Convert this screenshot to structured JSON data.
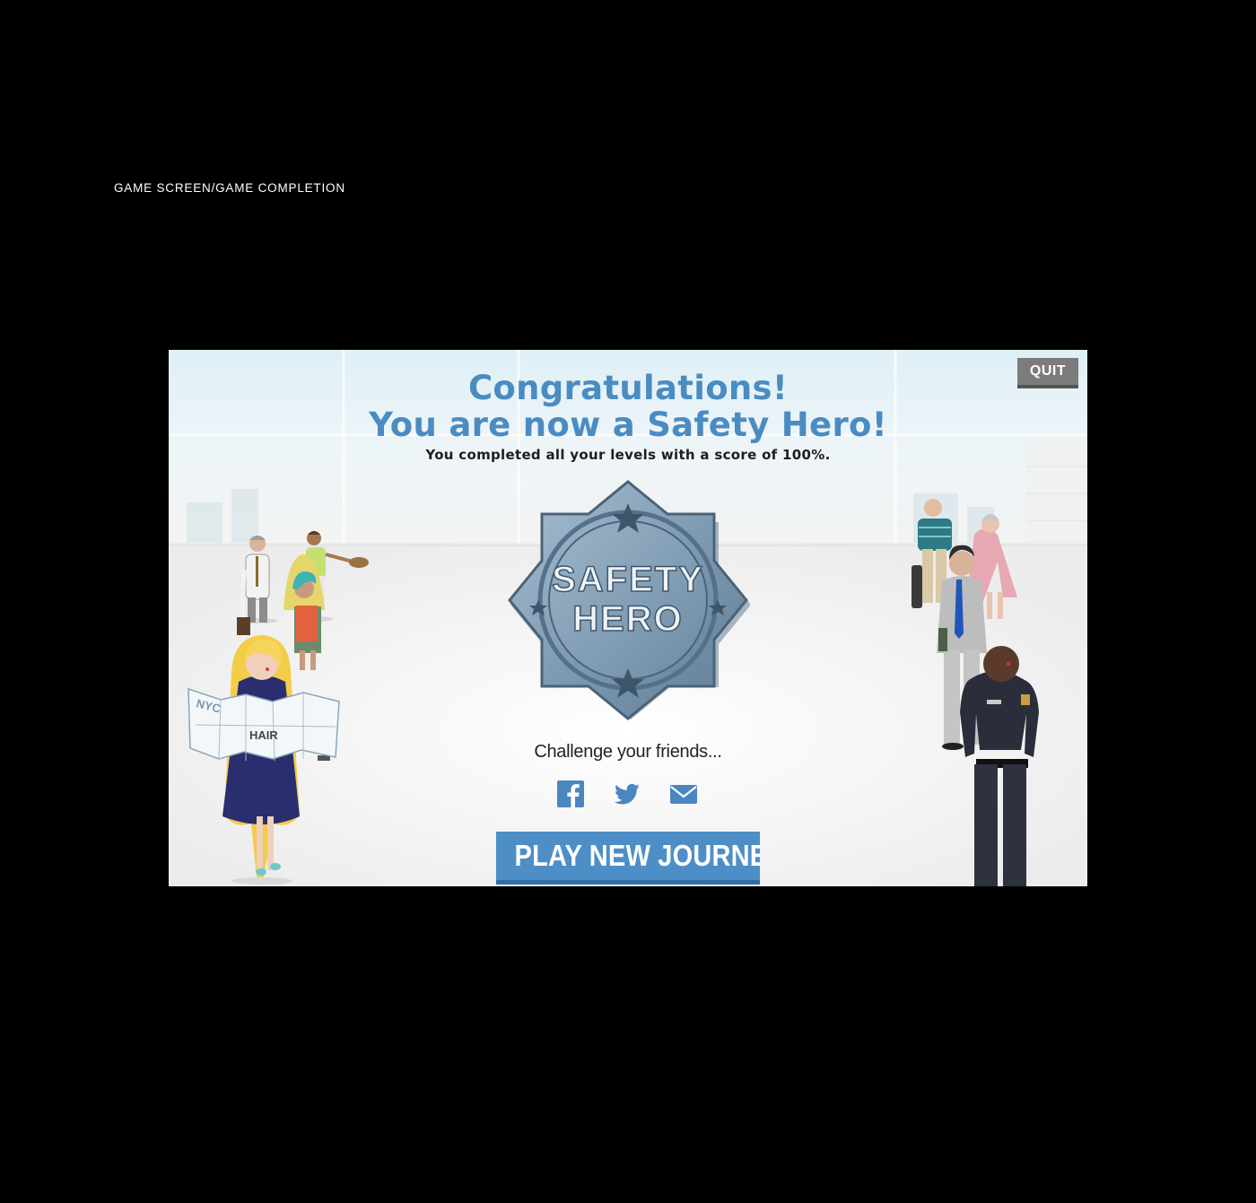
{
  "page_label": "GAME SCREEN/GAME COMPLETION",
  "game": {
    "quit_label": "QUIT",
    "title_line1": "Congratulations!",
    "title_line2": "You are now a Safety Hero!",
    "subtitle": "You completed all your levels with a score of 100%.",
    "badge": {
      "line1": "SAFETY",
      "line2": "HERO"
    },
    "challenge_text": "Challenge your friends...",
    "share_icons": [
      "facebook-icon",
      "twitter-icon",
      "email-icon"
    ],
    "play_button_label": "PLAY NEW JOURNEY",
    "map_text": {
      "nyc": "NYC",
      "hair": "HAIR"
    }
  },
  "colors": {
    "accent_blue": "#4a8cc2",
    "button_blue": "#4e8ec6",
    "quit_gray": "#7c7c7c",
    "background": "#000000"
  }
}
